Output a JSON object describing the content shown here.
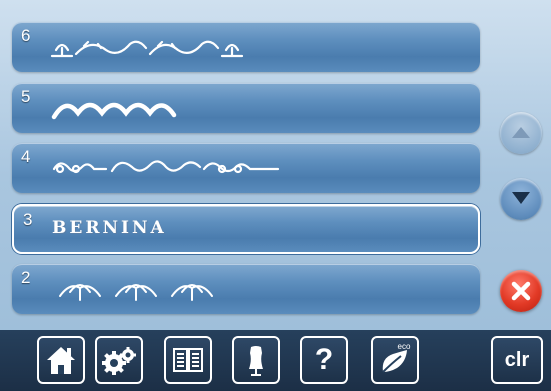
{
  "rows": [
    {
      "num": "6",
      "pattern": "lily-border-pattern"
    },
    {
      "num": "5",
      "pattern": "wave-scallop-pattern"
    },
    {
      "num": "4",
      "pattern": "scroll-vine-pattern"
    },
    {
      "num": "3",
      "text": "BERNINA",
      "selected": true
    },
    {
      "num": "2",
      "pattern": "leaf-arch-pattern"
    }
  ],
  "side_buttons": {
    "up": "arrow-up-icon",
    "down": "arrow-down-icon",
    "close": "close-x-icon"
  },
  "toolbar": {
    "items": [
      "home-icon",
      "settings-gears-icon",
      "tutorial-book-icon",
      "dress-form-icon",
      "help-icon",
      "eco-icon",
      "clr"
    ],
    "help_label": "?",
    "eco_label": "eco",
    "clr_label": "clr"
  },
  "colors": {
    "row": "#5e8fbe",
    "close": "#e23a26",
    "toolbar": "#1c2f46",
    "background": "#a9c6df"
  }
}
